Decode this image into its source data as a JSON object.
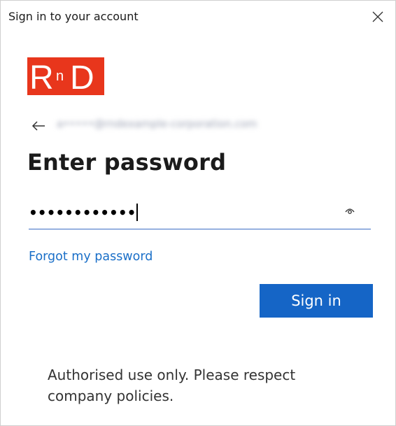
{
  "window": {
    "title": "Sign in to your account",
    "close_icon": "close-icon"
  },
  "logo": {
    "text_big_left": "R",
    "text_small": "n",
    "text_big_right": "D",
    "bg_color": "#e8361c"
  },
  "identity": {
    "back_icon": "back-arrow-icon",
    "email": "a•••••@rndexample-corporation.com"
  },
  "heading": "Enter password",
  "password": {
    "masked_value": "••••••••••••",
    "reveal_icon": "eye-icon",
    "underline_color": "#3a6dc4"
  },
  "links": {
    "forgot": "Forgot my password"
  },
  "buttons": {
    "sign_in": "Sign in",
    "primary_color": "#1565c6"
  },
  "notice": "Authorised use only. Please respect company policies."
}
